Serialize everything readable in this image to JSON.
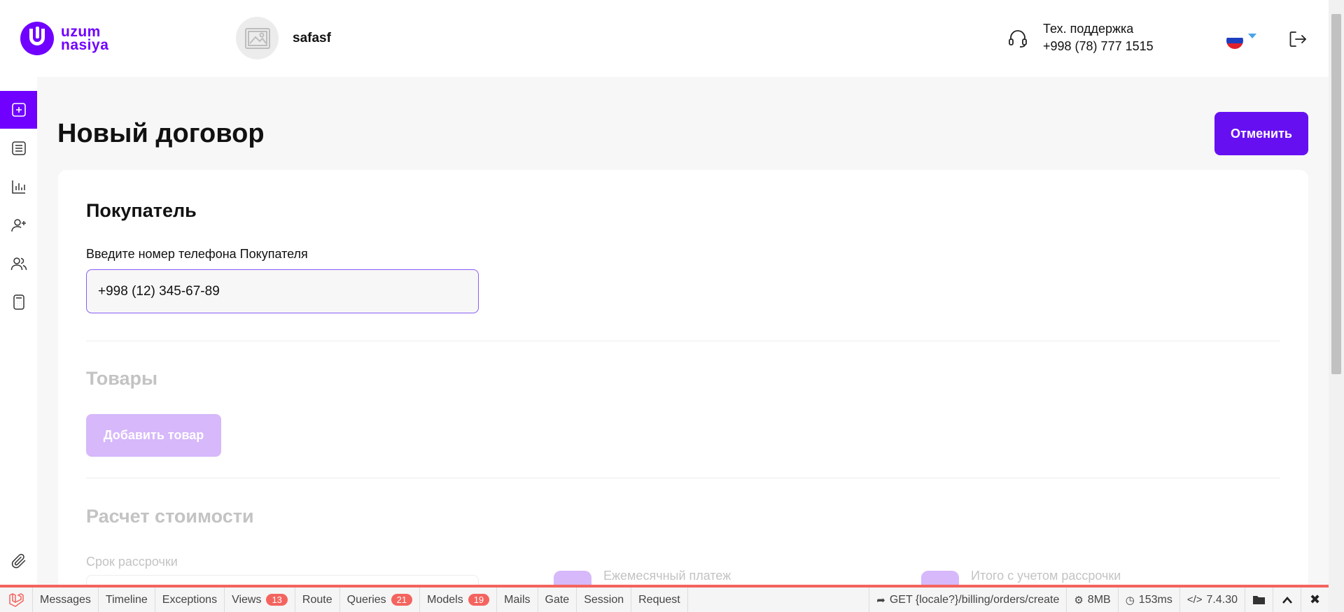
{
  "header": {
    "logo_line1": "uzum",
    "logo_line2": "nasiya",
    "username": "safasf",
    "support_label": "Тех. поддержка",
    "support_phone": "+998 (78) 777 1515",
    "language": "ru"
  },
  "sidebar": {
    "items": [
      "new-contract",
      "contracts-list",
      "analytics",
      "add-client",
      "clients",
      "calculator"
    ]
  },
  "page": {
    "title": "Новый договор",
    "cancel_label": "Отменить"
  },
  "buyer": {
    "title": "Покупатель",
    "phone_label": "Введите номер телефона Покупателя",
    "phone_value": "+998 (12) 345-67-89"
  },
  "goods": {
    "title": "Товары",
    "add_label": "Добавить товар"
  },
  "calc": {
    "title": "Расчет стоимости",
    "term_label": "Срок рассрочки",
    "monthly_label": "Ежемесячный платеж",
    "total_label": "Итого с учетом рассрочки"
  },
  "colors": {
    "accent": "#7000ff",
    "button": "#6610f2",
    "disabled_button": "#d6b8fb",
    "debug_accent": "#f4645f"
  },
  "debugbar": {
    "tabs": [
      {
        "label": "Messages"
      },
      {
        "label": "Timeline"
      },
      {
        "label": "Exceptions"
      },
      {
        "label": "Views",
        "badge": "13"
      },
      {
        "label": "Route"
      },
      {
        "label": "Queries",
        "badge": "21"
      },
      {
        "label": "Models",
        "badge": "19"
      },
      {
        "label": "Mails"
      },
      {
        "label": "Gate"
      },
      {
        "label": "Session"
      },
      {
        "label": "Request"
      }
    ],
    "route": "GET {locale?}/billing/orders/create",
    "memory": "8MB",
    "time": "153ms",
    "php": "7.4.30"
  }
}
